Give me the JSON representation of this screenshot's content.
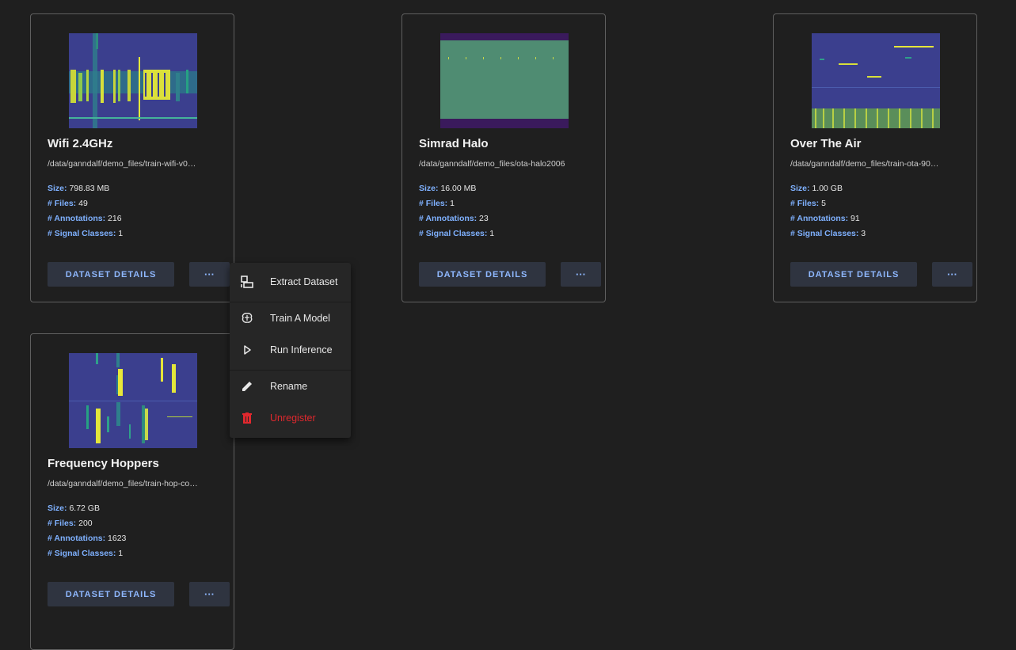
{
  "cards": [
    {
      "title": "Wifi 2.4GHz",
      "path": "/data/ganndalf/demo_files/train-wifi-v0…",
      "size_key": "Size:",
      "size_val": "798.83 MB",
      "files_key": "# Files:",
      "files_val": "49",
      "ann_key": "# Annotations:",
      "ann_val": "216",
      "classes_key": "# Signal Classes:",
      "classes_val": "1",
      "details_label": "DATASET DETAILS",
      "more_label": "···"
    },
    {
      "title": "Simrad Halo",
      "path": "/data/ganndalf/demo_files/ota-halo2006",
      "size_key": "Size:",
      "size_val": "16.00 MB",
      "files_key": "# Files:",
      "files_val": "1",
      "ann_key": "# Annotations:",
      "ann_val": "23",
      "classes_key": "# Signal Classes:",
      "classes_val": "1",
      "details_label": "DATASET DETAILS",
      "more_label": "···"
    },
    {
      "title": "Over The Air",
      "path": "/data/ganndalf/demo_files/train-ota-90…",
      "size_key": "Size:",
      "size_val": "1.00 GB",
      "files_key": "# Files:",
      "files_val": "5",
      "ann_key": "# Annotations:",
      "ann_val": "91",
      "classes_key": "# Signal Classes:",
      "classes_val": "3",
      "details_label": "DATASET DETAILS",
      "more_label": "···"
    },
    {
      "title": "Frequency Hoppers",
      "path": "/data/ganndalf/demo_files/train-hop-co…",
      "size_key": "Size:",
      "size_val": "6.72 GB",
      "files_key": "# Files:",
      "files_val": "200",
      "ann_key": "# Annotations:",
      "ann_val": "1623",
      "classes_key": "# Signal Classes:",
      "classes_val": "1",
      "details_label": "DATASET DETAILS",
      "more_label": "···"
    }
  ],
  "menu": {
    "items": [
      {
        "label": "Extract Dataset",
        "icon": "extract-icon"
      },
      {
        "label": "Train A Model",
        "icon": "brain-icon"
      },
      {
        "label": "Run Inference",
        "icon": "play-icon"
      },
      {
        "label": "Rename",
        "icon": "pencil-icon"
      },
      {
        "label": "Unregister",
        "icon": "trash-icon"
      }
    ]
  },
  "colors": {
    "background": "#1f1f1f",
    "accent": "#7fb1ff",
    "button_bg": "#2f3440",
    "danger": "#e0282e"
  }
}
